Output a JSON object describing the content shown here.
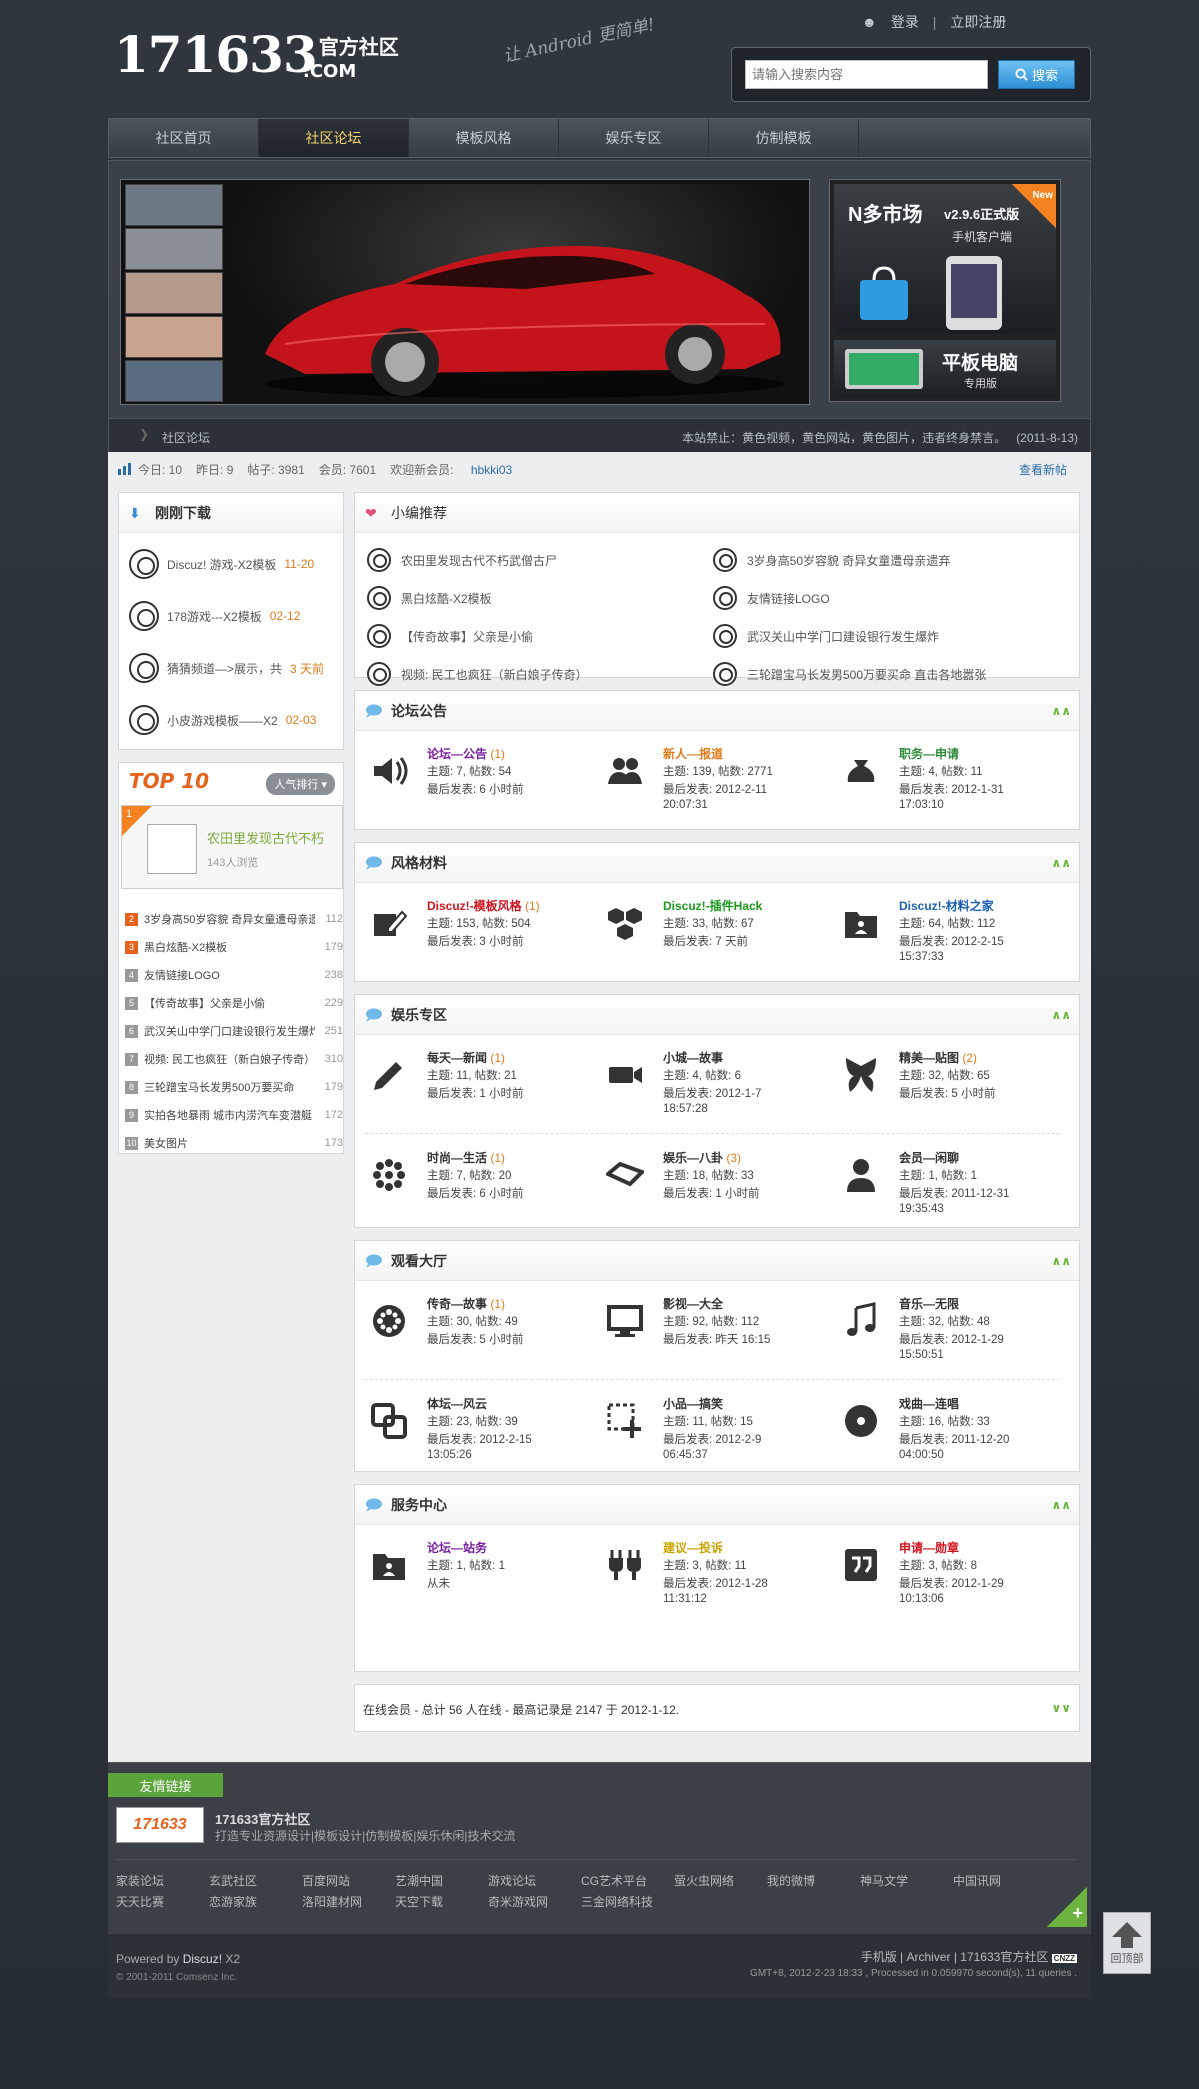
{
  "header": {
    "logo_number": "171633",
    "logo_cn": "官方社区",
    "logo_com": ".COM",
    "slogan": "让 Android 更简单!",
    "login": "登录",
    "register": "立即注册",
    "search_placeholder": "请输入搜索内容",
    "search_button": "搜索"
  },
  "nav": [
    "社区首页",
    "社区论坛",
    "模板风格",
    "娱乐专区",
    "仿制模板"
  ],
  "banner": {
    "ad1_title": "N多市场",
    "ad1_version": "v2.9.6正式版",
    "ad1_sub": "手机客户端",
    "new_tag": "New",
    "ad2_title": "平板电脑",
    "ad2_sub": "专用版",
    "breadcrumb": "社区论坛",
    "notice": "本站禁止：黄色视频，黄色网站，黄色图片，违者终身禁言。",
    "notice_date": "(2011-8-13)"
  },
  "stats": {
    "today": "今日: 10",
    "yesterday": "昨日: 9",
    "posts": "帖子: 3981",
    "members": "会员: 7601",
    "welcome": "欢迎新会员:",
    "new_member": "hbkki03",
    "more": "查看新帖"
  },
  "downloads": {
    "title": "刚刚下载",
    "items": [
      {
        "name": "Discuz! 游戏-X2模板",
        "date": "11-20"
      },
      {
        "name": "178游戏---X2模板",
        "date": "02-12"
      },
      {
        "name": "猜猜频道—>展示，共",
        "date": "3 天前"
      },
      {
        "name": "小皮游戏模板——X2",
        "date": "02-03"
      }
    ]
  },
  "top10": {
    "title": "TOP 10",
    "rank_button": "人气排行",
    "first_num": "1",
    "first_title": "农田里发现古代不朽",
    "first_views": "143人浏览",
    "items": [
      {
        "rank": "2",
        "title": "3岁身高50岁容貌 奇异女童遭母亲遗弃",
        "count": "112"
      },
      {
        "rank": "3",
        "title": "黑白炫酷-X2模板",
        "count": "179"
      },
      {
        "rank": "4",
        "title": "友情链接LOGO",
        "count": "238"
      },
      {
        "rank": "5",
        "title": "【传奇故事】父亲是小偷",
        "count": "229"
      },
      {
        "rank": "6",
        "title": "武汉关山中学门口建设银行发生爆炸",
        "count": "251"
      },
      {
        "rank": "7",
        "title": "视频: 民工也疯狂（新白娘子传奇）",
        "count": "310"
      },
      {
        "rank": "8",
        "title": "三轮蹭宝马长发男500万要买命",
        "count": "179"
      },
      {
        "rank": "9",
        "title": "实拍各地暴雨 城市内涝汽车变潜艇",
        "count": "172"
      },
      {
        "rank": "10",
        "title": "美女图片",
        "count": "173"
      }
    ]
  },
  "recommend": {
    "title": "小编推荐",
    "items": [
      "农田里发现古代不朽武僧古尸",
      "3岁身高50岁容貌 奇异女童遭母亲遗弃",
      "黑白炫酷-X2模板",
      "友情链接LOGO",
      "【传奇故事】父亲是小偷",
      "武汉关山中学门口建设银行发生爆炸",
      "视频: 民工也疯狂（新白娘子传奇）",
      "三轮蹭宝马长发男500万要买命 直击各地嚣张",
      "实拍各地暴雨 城市内涝汽车变潜艇",
      "美女图片"
    ]
  },
  "sections": [
    {
      "title": "论坛公告",
      "forums": [
        {
          "name": "论坛—公告",
          "count": "(1)",
          "color": "#7a1fa2",
          "icon": "speaker-icon",
          "l1": "主题: 7, 帖数: 54",
          "l2": "最后发表: 6 小时前",
          "l3": ""
        },
        {
          "name": "新人—报道",
          "count": "",
          "color": "#e07b1b",
          "icon": "users-icon",
          "l1": "主题: 139, 帖数: 2771",
          "l2": "最后发表: 2012-2-11",
          "l3": "20:07:31"
        },
        {
          "name": "职务—申请",
          "count": "",
          "color": "#2e8b3a",
          "icon": "money-bag-icon",
          "l1": "主题: 4, 帖数: 11",
          "l2": "最后发表: 2012-1-31",
          "l3": "17:03:10"
        }
      ]
    },
    {
      "title": "风格材料",
      "forums": [
        {
          "name": "Discuz!-模板风格",
          "count": "(1)",
          "color": "#d0141f",
          "icon": "edit-icon",
          "l1": "主题: 153, 帖数: 504",
          "l2": "最后发表: 3 小时前",
          "l3": ""
        },
        {
          "name": "Discuz!-插件Hack",
          "count": "",
          "color": "#1e9a1e",
          "icon": "hexagons-icon",
          "l1": "主题: 33, 帖数: 67",
          "l2": "最后发表: 7 天前",
          "l3": ""
        },
        {
          "name": "Discuz!-材料之家",
          "count": "",
          "color": "#1e5fb0",
          "icon": "folder-icon",
          "l1": "主题: 64, 帖数: 112",
          "l2": "最后发表: 2012-2-15",
          "l3": "15:37:33"
        }
      ]
    },
    {
      "title": "娱乐专区",
      "forums": [
        {
          "name": "每天—新闻",
          "count": "(1)",
          "color": "#333333",
          "icon": "pencil-icon",
          "l1": "主题: 11, 帖数: 21",
          "l2": "最后发表: 1 小时前",
          "l3": ""
        },
        {
          "name": "小城—故事",
          "count": "",
          "color": "#333333",
          "icon": "video-camera-icon",
          "l1": "主题: 4, 帖数: 6",
          "l2": "最后发表: 2012-1-7",
          "l3": "18:57:28"
        },
        {
          "name": "精美—贴图",
          "count": "(2)",
          "color": "#333333",
          "icon": "butterfly-icon",
          "l1": "主题: 32, 帖数: 65",
          "l2": "最后发表: 5 小时前",
          "l3": ""
        },
        {
          "name": "时尚—生活",
          "count": "(1)",
          "color": "#333333",
          "icon": "flower-icon",
          "l1": "主题: 7, 帖数: 20",
          "l2": "最后发表: 6 小时前",
          "l3": ""
        },
        {
          "name": "娱乐—八卦",
          "count": "(3)",
          "color": "#333333",
          "icon": "ticket-icon",
          "l1": "主题: 18, 帖数: 33",
          "l2": "最后发表: 1 小时前",
          "l3": ""
        },
        {
          "name": "会员—闲聊",
          "count": "",
          "color": "#333333",
          "icon": "person-icon",
          "l1": "主题: 1, 帖数: 1",
          "l2": "最后发表: 2011-12-31",
          "l3": "19:35:43"
        }
      ]
    },
    {
      "title": "观看大厅",
      "forums": [
        {
          "name": "传奇—故事",
          "count": "(1)",
          "color": "#333333",
          "icon": "film-reel-icon",
          "l1": "主题: 30, 帖数: 49",
          "l2": "最后发表: 5 小时前",
          "l3": ""
        },
        {
          "name": "影视—大全",
          "count": "",
          "color": "#333333",
          "icon": "monitor-icon",
          "l1": "主题: 92, 帖数: 112",
          "l2": "最后发表: 昨天 16:15",
          "l3": ""
        },
        {
          "name": "音乐—无限",
          "count": "",
          "color": "#333333",
          "icon": "music-note-icon",
          "l1": "主题: 32, 帖数: 48",
          "l2": "最后发表: 2012-1-29",
          "l3": "15:50:51"
        },
        {
          "name": "体坛—风云",
          "count": "",
          "color": "#333333",
          "icon": "squares-icon",
          "l1": "主题: 23, 帖数: 39",
          "l2": "最后发表: 2012-2-15",
          "l3": "13:05:26"
        },
        {
          "name": "小品—搞笑",
          "count": "",
          "color": "#333333",
          "icon": "add-box-icon",
          "l1": "主题: 11, 帖数: 15",
          "l2": "最后发表: 2012-2-9",
          "l3": "06:45:37"
        },
        {
          "name": "戏曲—连唱",
          "count": "",
          "color": "#333333",
          "icon": "disc-icon",
          "l1": "主题: 16, 帖数: 33",
          "l2": "最后发表: 2011-12-20",
          "l3": "04:00:50"
        }
      ]
    },
    {
      "title": "服务中心",
      "forums": [
        {
          "name": "论坛—站务",
          "count": "",
          "color": "#7a1fa2",
          "icon": "folder-user-icon",
          "l1": "主题: 1, 帖数: 1",
          "l2": "从未",
          "l3": ""
        },
        {
          "name": "建议—投诉",
          "count": "",
          "color": "#c9a500",
          "icon": "plug-icon",
          "l1": "主题: 3, 帖数: 11",
          "l2": "最后发表: 2012-1-28",
          "l3": "11:31:12"
        },
        {
          "name": "申请—勋章",
          "count": "",
          "color": "#d0141f",
          "icon": "quote-icon",
          "l1": "主题: 3, 帖数: 8",
          "l2": "最后发表: 2012-1-29",
          "l3": "10:13:06"
        }
      ]
    }
  ],
  "online": "在线会员 - 总计 56 人在线 - 最高记录是 2147 于 2012-1-12.",
  "footer": {
    "links_title": "友情链接",
    "logo_text": "171633",
    "site_name": "171633官方社区",
    "site_desc": "打造专业资源设计|模板设计|仿制模板|娱乐休闲|技术交流",
    "links": [
      "家装论坛",
      "玄武社区",
      "百度网站",
      "艺潮中国",
      "游戏论坛",
      "CG艺术平台",
      "萤火虫网络",
      "我的微博",
      "神马文学",
      "中国讯网",
      "天天比赛",
      "恋游家族",
      "洛阳建材网",
      "天空下载",
      "奇米游戏网",
      "三金网络科技"
    ],
    "powered_by": "Powered by",
    "discuz": "Discuz!",
    "version": "X2",
    "copyright": "© 2001-2011 Comsenz Inc.",
    "right_links": "手机版 | Archiver | 171633官方社区",
    "cnzz": "CNZZ",
    "gmt": "GMT+8, 2012-2-23 18:33 , Processed in 0.059970 second(s), 11 queries .",
    "gotop": "回顶部"
  }
}
